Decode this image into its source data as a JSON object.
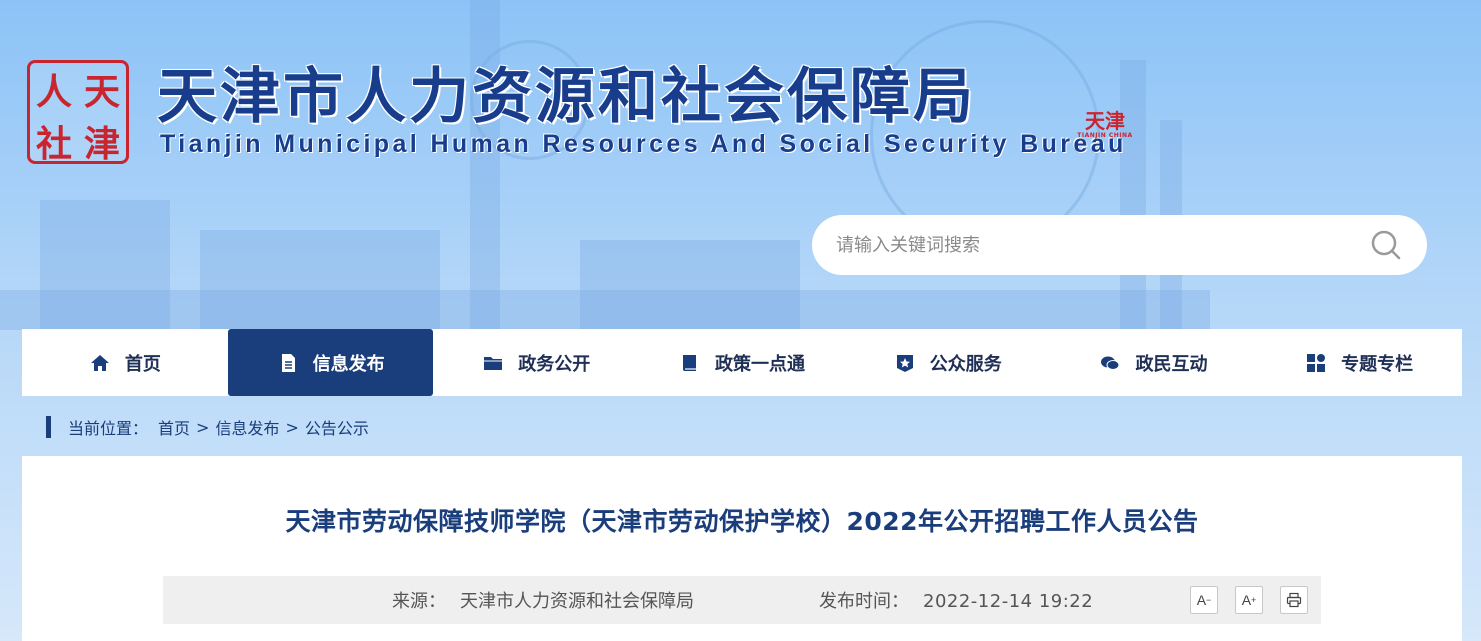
{
  "header": {
    "logo_chars": [
      "人",
      "天",
      "社",
      "津"
    ],
    "title_cn": "天津市人力资源和社会保障局",
    "title_en": "Tianjin Municipal Human Resources And Social Security Bureau",
    "stamp_text": "天津",
    "stamp_sub": "TIANJIN CHINA"
  },
  "search": {
    "placeholder": "请输入关键词搜索"
  },
  "nav": {
    "items": [
      {
        "label": "首页",
        "icon": "home-icon"
      },
      {
        "label": "信息发布",
        "icon": "document-icon",
        "active": true
      },
      {
        "label": "政务公开",
        "icon": "folder-icon"
      },
      {
        "label": "政策一点通",
        "icon": "book-icon"
      },
      {
        "label": "公众服务",
        "icon": "star-badge-icon"
      },
      {
        "label": "政民互动",
        "icon": "chat-icon"
      },
      {
        "label": "专题专栏",
        "icon": "grid-icon"
      }
    ]
  },
  "breadcrumb": {
    "prefix": "当前位置：",
    "items": [
      "首页",
      "信息发布",
      "公告公示"
    ],
    "separator": ">"
  },
  "article": {
    "title": "天津市劳动保障技师学院（天津市劳动保护学校）2022年公开招聘工作人员公告",
    "source_label": "来源：",
    "source_value": "天津市人力资源和社会保障局",
    "time_label": "发布时间：",
    "time_value": "2022-12-14 19:22"
  },
  "tools": {
    "font_decrease": "A",
    "font_decrease_mark": "−",
    "font_increase": "A",
    "font_increase_mark": "+",
    "print_icon": "printer-icon"
  },
  "colors": {
    "brand_blue": "#1a3d7c",
    "seal_red": "#c9252f"
  }
}
